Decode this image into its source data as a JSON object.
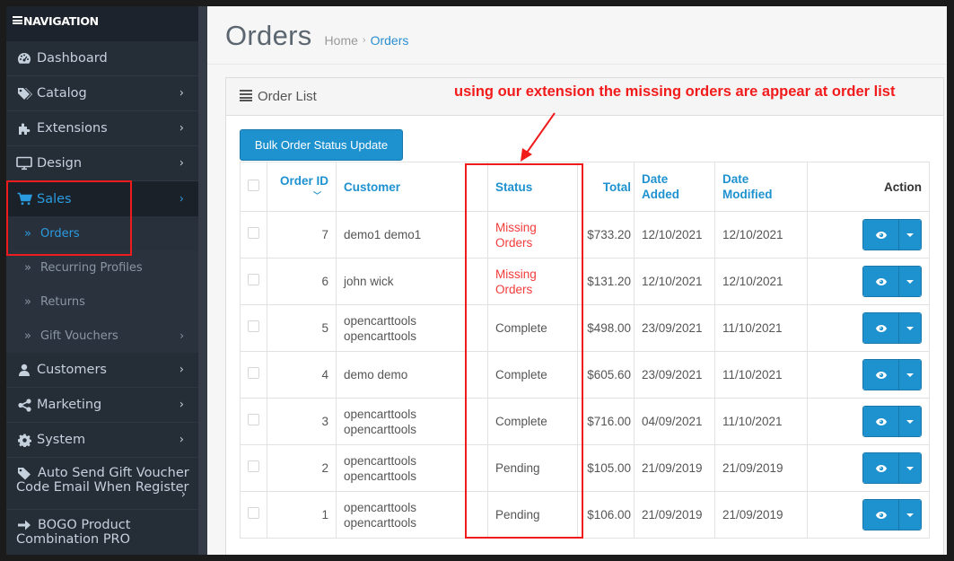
{
  "sidebar": {
    "header": "NAVIGATION",
    "items": [
      {
        "label": "Dashboard",
        "icon": "dashboard-icon"
      },
      {
        "label": "Catalog",
        "icon": "tag-icon"
      },
      {
        "label": "Extensions",
        "icon": "puzzle-icon"
      },
      {
        "label": "Design",
        "icon": "monitor-icon"
      },
      {
        "label": "Sales",
        "icon": "cart-icon"
      },
      {
        "label": "Customers",
        "icon": "user-icon"
      },
      {
        "label": "Marketing",
        "icon": "share-icon"
      },
      {
        "label": "System",
        "icon": "gear-icon"
      },
      {
        "label_line1": "Auto Send Gift Voucher",
        "label_line2": "Code Email When Register",
        "icon": "tag-icon"
      },
      {
        "label_line1": "BOGO Product",
        "label_line2": "Combination PRO",
        "icon": "arrow-right-icon"
      }
    ],
    "sales_sub": [
      {
        "label": "Orders"
      },
      {
        "label": "Recurring Profiles"
      },
      {
        "label": "Returns"
      },
      {
        "label": "Gift Vouchers"
      }
    ]
  },
  "header": {
    "title": "Orders",
    "breadcrumb": [
      "Home",
      "Orders"
    ],
    "breadcrumb_sep": "›"
  },
  "panel": {
    "title": "Order List",
    "bulk_button": "Bulk Order Status Update",
    "annotation": "using our extension the missing orders are appear at order list"
  },
  "table": {
    "columns": {
      "order_id": "Order ID",
      "customer": "Customer",
      "status": "Status",
      "total": "Total",
      "date_added_1": "Date",
      "date_added_2": "Added",
      "date_modified_1": "Date",
      "date_modified_2": "Modified",
      "action": "Action"
    },
    "rows": [
      {
        "id": "7",
        "customer_1": "demo1 demo1",
        "customer_2": "",
        "status_1": "Missing",
        "status_2": "Orders",
        "total": "$733.20",
        "date_added": "12/10/2021",
        "date_modified": "12/10/2021"
      },
      {
        "id": "6",
        "customer_1": "john wick",
        "customer_2": "",
        "status_1": "Missing",
        "status_2": "Orders",
        "total": "$131.20",
        "date_added": "12/10/2021",
        "date_modified": "12/10/2021"
      },
      {
        "id": "5",
        "customer_1": "opencarttools",
        "customer_2": "opencarttools",
        "status_1": "Complete",
        "status_2": "",
        "total": "$498.00",
        "date_added": "23/09/2021",
        "date_modified": "11/10/2021"
      },
      {
        "id": "4",
        "customer_1": "demo demo",
        "customer_2": "",
        "status_1": "Complete",
        "status_2": "",
        "total": "$605.60",
        "date_added": "23/09/2021",
        "date_modified": "11/10/2021"
      },
      {
        "id": "3",
        "customer_1": "opencarttools",
        "customer_2": "opencarttools",
        "status_1": "Complete",
        "status_2": "",
        "total": "$716.00",
        "date_added": "04/09/2021",
        "date_modified": "11/10/2021"
      },
      {
        "id": "2",
        "customer_1": "opencarttools",
        "customer_2": "opencarttools",
        "status_1": "Pending",
        "status_2": "",
        "total": "$105.00",
        "date_added": "21/09/2019",
        "date_modified": "21/09/2019"
      },
      {
        "id": "1",
        "customer_1": "opencarttools",
        "customer_2": "opencarttools",
        "status_1": "Pending",
        "status_2": "",
        "total": "$106.00",
        "date_added": "21/09/2019",
        "date_modified": "21/09/2019"
      }
    ]
  },
  "colors": {
    "accent": "#1e91cf",
    "missing_status": "#f33b3b",
    "annotation": "#f21b1b",
    "sidebar_bg": "#252d37"
  }
}
